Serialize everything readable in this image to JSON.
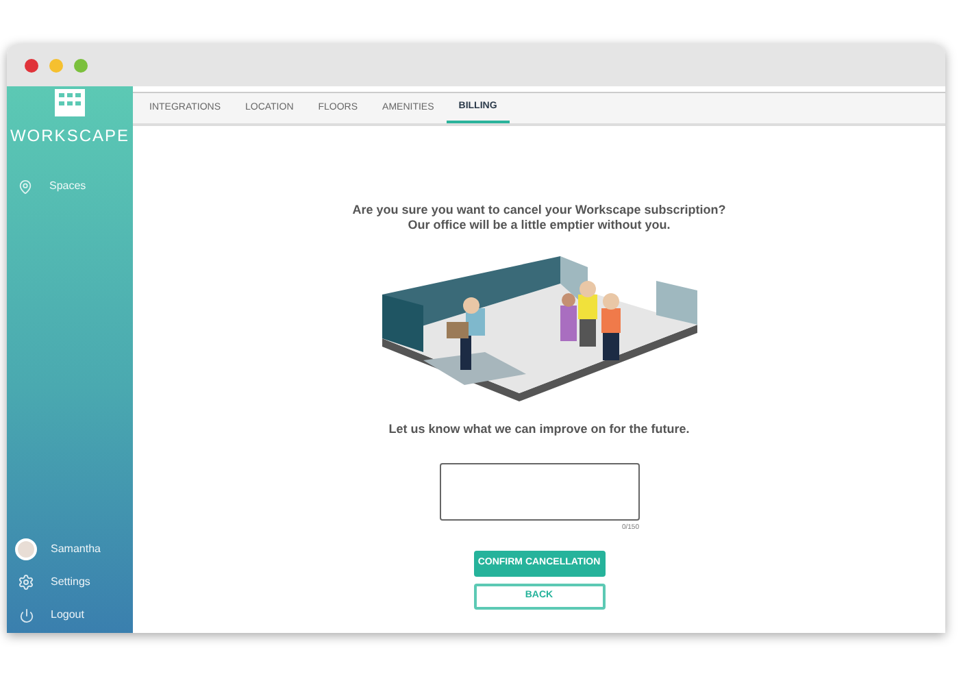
{
  "sidebar": {
    "brand": "WORKSCAPE",
    "items": [
      {
        "label": "Spaces",
        "kind": "location"
      }
    ],
    "bottom_items": [
      {
        "label": "Samantha",
        "kind": "profile"
      },
      {
        "label": "Settings",
        "kind": "settings"
      },
      {
        "label": "Logout",
        "kind": "logout"
      }
    ]
  },
  "tabs": [
    {
      "label": "INTEGRATIONS",
      "selected": false
    },
    {
      "label": "LOCATION",
      "selected": false
    },
    {
      "label": "FLOORS",
      "selected": false
    },
    {
      "label": "AMENITIES",
      "selected": false
    },
    {
      "label": "BILLING",
      "selected": true
    }
  ],
  "heading": [
    "Are you sure you want to cancel your Workscape subscription?",
    "Our office will be a little emptier without you."
  ],
  "prompt": "Let us know what we can improve on for the future.",
  "feedback": {
    "counter": "0/150"
  },
  "buttons": [
    {
      "label": "CONFIRM CANCELLATION",
      "kind": "primary"
    },
    {
      "label": "BACK",
      "kind": "outline"
    }
  ]
}
